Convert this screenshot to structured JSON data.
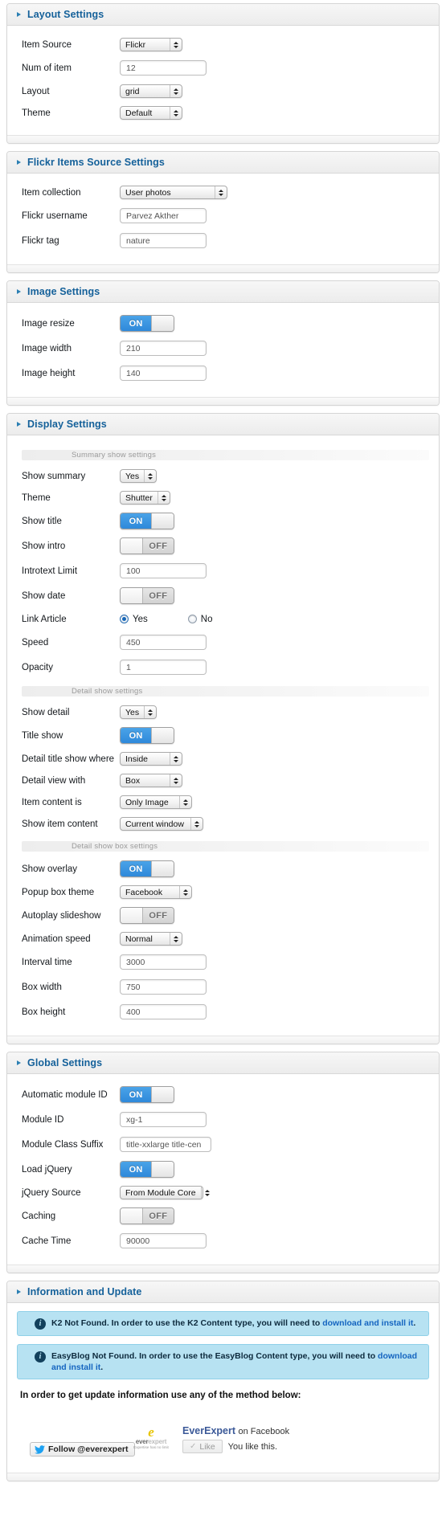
{
  "sections": {
    "layout": {
      "title": "Layout Settings",
      "rows": {
        "item_source": {
          "label": "Item Source",
          "value": "Flickr"
        },
        "num_of_item": {
          "label": "Num of item",
          "value": "12"
        },
        "layout": {
          "label": "Layout",
          "value": "grid"
        },
        "theme": {
          "label": "Theme",
          "value": "Default"
        }
      }
    },
    "flickr": {
      "title": "Flickr Items Source Settings",
      "rows": {
        "item_collection": {
          "label": "Item collection",
          "value": "User photos"
        },
        "flickr_username": {
          "label": "Flickr username",
          "value": "Parvez Akther"
        },
        "flickr_tag": {
          "label": "Flickr tag",
          "value": "nature"
        }
      }
    },
    "image": {
      "title": "Image Settings",
      "rows": {
        "image_resize": {
          "label": "Image resize",
          "value": "ON"
        },
        "image_width": {
          "label": "Image width",
          "value": "210"
        },
        "image_height": {
          "label": "Image height",
          "value": "140"
        }
      }
    },
    "display": {
      "title": "Display Settings",
      "subheads": {
        "summary": "Summary show settings",
        "detail": "Detail show settings",
        "detail_box": "Detail show box settings"
      },
      "rows": {
        "show_summary": {
          "label": "Show summary",
          "value": "Yes"
        },
        "theme": {
          "label": "Theme",
          "value": "Shutter"
        },
        "show_title": {
          "label": "Show title",
          "value": "ON"
        },
        "show_intro": {
          "label": "Show intro",
          "value": "OFF"
        },
        "introtext_limit": {
          "label": "Introtext Limit",
          "value": "100"
        },
        "show_date": {
          "label": "Show date",
          "value": "OFF"
        },
        "link_article": {
          "label": "Link Article",
          "yes": "Yes",
          "no": "No",
          "selected": "Yes"
        },
        "speed": {
          "label": "Speed",
          "value": "450"
        },
        "opacity": {
          "label": "Opacity",
          "value": "1"
        },
        "show_detail": {
          "label": "Show detail",
          "value": "Yes"
        },
        "title_show": {
          "label": "Title show",
          "value": "ON"
        },
        "detail_title_show_where": {
          "label": "Detail title show where",
          "value": "Inside"
        },
        "detail_view_with": {
          "label": "Detail view with",
          "value": "Box"
        },
        "item_content_is": {
          "label": "Item content is",
          "value": "Only Image"
        },
        "show_item_content": {
          "label": "Show item content",
          "value": "Current window"
        },
        "show_overlay": {
          "label": "Show overlay",
          "value": "ON"
        },
        "popup_box_theme": {
          "label": "Popup box theme",
          "value": "Facebook"
        },
        "autoplay_slideshow": {
          "label": "Autoplay slideshow",
          "value": "OFF"
        },
        "animation_speed": {
          "label": "Animation speed",
          "value": "Normal"
        },
        "interval_time": {
          "label": "Interval time",
          "value": "3000"
        },
        "box_width": {
          "label": "Box width",
          "value": "750"
        },
        "box_height": {
          "label": "Box height",
          "value": "400"
        }
      }
    },
    "global": {
      "title": "Global Settings",
      "rows": {
        "automatic_module_id": {
          "label": "Automatic module ID",
          "value": "ON"
        },
        "module_id": {
          "label": "Module ID",
          "value": "xg-1"
        },
        "module_class_suffix": {
          "label": "Module Class Suffix",
          "value": "title-xxlarge title-cen"
        },
        "load_jquery": {
          "label": "Load jQuery",
          "value": "ON"
        },
        "jquery_source": {
          "label": "jQuery Source",
          "value": "From Module Core"
        },
        "caching": {
          "label": "Caching",
          "value": "OFF"
        },
        "cache_time": {
          "label": "Cache Time",
          "value": "90000"
        }
      }
    },
    "information": {
      "title": "Information and Update",
      "alerts": [
        {
          "text_before": "K2 Not Found. In order to use the K2 Content type, you will need to ",
          "link": "download and install it",
          "text_after": "."
        },
        {
          "text_before": "EasyBlog Not Found. In order to use the EasyBlog Content type, you will need to ",
          "link": "download and install it",
          "text_after": "."
        }
      ],
      "note": "In order to get update information use any of the method below:",
      "twitter_button": "Follow @everexpert",
      "logo": {
        "mark": "e",
        "word_dark": "ever",
        "word_grey": "expert",
        "tagline": "Expertise has no limit"
      },
      "facebook": {
        "brand": "EverExpert",
        "suffix": "on Facebook",
        "like_label": "Like",
        "status": "You like this."
      }
    }
  },
  "colors": {
    "heading": "#15619a",
    "toggle_on": "#2f89da",
    "alert_bg": "#b7e2f2",
    "link": "#1565c0"
  }
}
